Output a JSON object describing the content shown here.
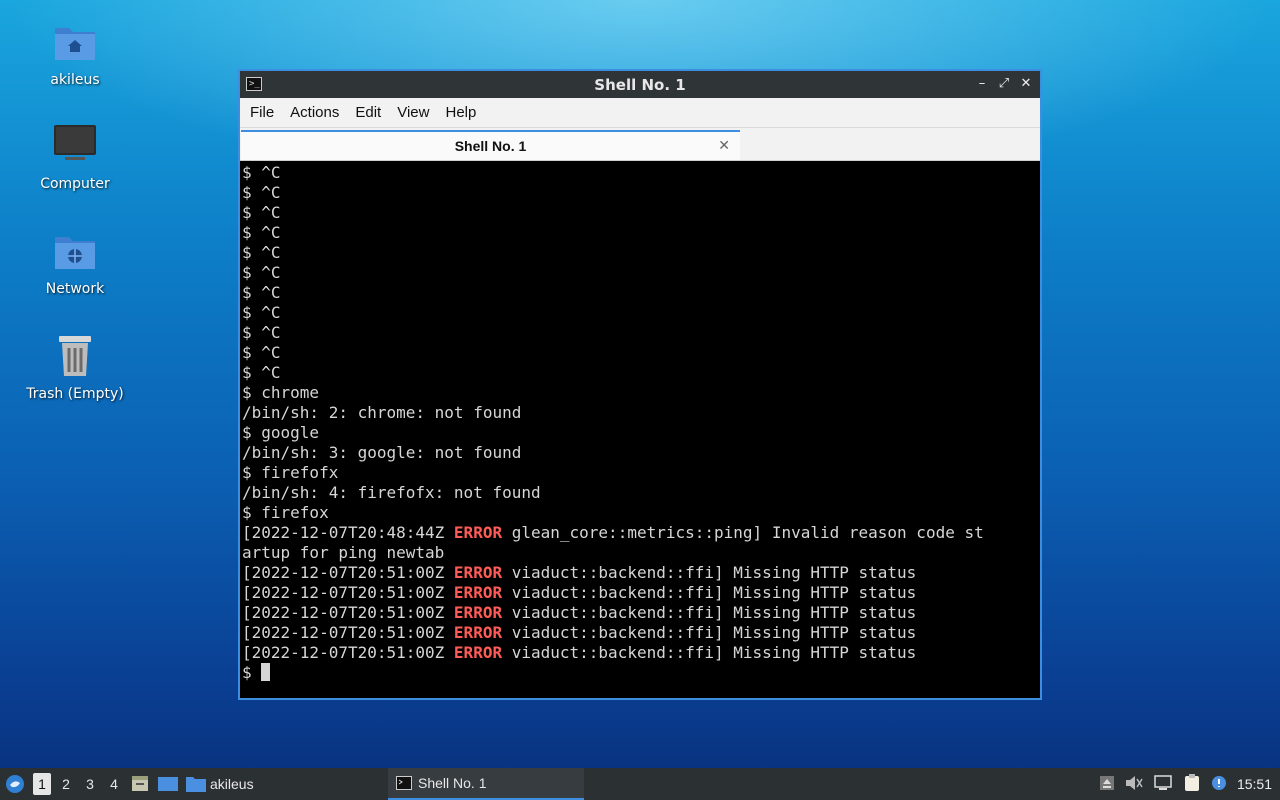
{
  "desktop": {
    "icons": [
      {
        "label": "akileus",
        "icon": "home-folder-icon"
      },
      {
        "label": "Computer",
        "icon": "computer-icon"
      },
      {
        "label": "Network",
        "icon": "network-folder-icon"
      },
      {
        "label": "Trash (Empty)",
        "icon": "trash-icon"
      }
    ]
  },
  "window": {
    "title": "Shell No. 1",
    "menu": [
      "File",
      "Actions",
      "Edit",
      "View",
      "Help"
    ],
    "tab_label": "Shell No. 1",
    "tab_close": "✕"
  },
  "terminal": {
    "lines": [
      [
        {
          "t": "$ ^C"
        }
      ],
      [
        {
          "t": "$ ^C"
        }
      ],
      [
        {
          "t": "$ ^C"
        }
      ],
      [
        {
          "t": "$ ^C"
        }
      ],
      [
        {
          "t": "$ ^C"
        }
      ],
      [
        {
          "t": "$ ^C"
        }
      ],
      [
        {
          "t": "$ ^C"
        }
      ],
      [
        {
          "t": "$ ^C"
        }
      ],
      [
        {
          "t": "$ ^C"
        }
      ],
      [
        {
          "t": "$ ^C"
        }
      ],
      [
        {
          "t": "$ ^C"
        }
      ],
      [
        {
          "t": "$ chrome"
        }
      ],
      [
        {
          "t": "/bin/sh: 2: chrome: not found"
        }
      ],
      [
        {
          "t": "$ google"
        }
      ],
      [
        {
          "t": "/bin/sh: 3: google: not found"
        }
      ],
      [
        {
          "t": "$ firefofx"
        }
      ],
      [
        {
          "t": "/bin/sh: 4: firefofx: not found"
        }
      ],
      [
        {
          "t": "$ firefox"
        }
      ],
      [
        {
          "t": "[2022-12-07T20:48:44Z "
        },
        {
          "t": "ERROR",
          "err": true
        },
        {
          "t": " glean_core::metrics::ping] Invalid reason code st"
        }
      ],
      [
        {
          "t": "artup for ping newtab"
        }
      ],
      [
        {
          "t": "[2022-12-07T20:51:00Z "
        },
        {
          "t": "ERROR",
          "err": true
        },
        {
          "t": " viaduct::backend::ffi] Missing HTTP status"
        }
      ],
      [
        {
          "t": "[2022-12-07T20:51:00Z "
        },
        {
          "t": "ERROR",
          "err": true
        },
        {
          "t": " viaduct::backend::ffi] Missing HTTP status"
        }
      ],
      [
        {
          "t": "[2022-12-07T20:51:00Z "
        },
        {
          "t": "ERROR",
          "err": true
        },
        {
          "t": " viaduct::backend::ffi] Missing HTTP status"
        }
      ],
      [
        {
          "t": "[2022-12-07T20:51:00Z "
        },
        {
          "t": "ERROR",
          "err": true
        },
        {
          "t": " viaduct::backend::ffi] Missing HTTP status"
        }
      ],
      [
        {
          "t": "[2022-12-07T20:51:00Z "
        },
        {
          "t": "ERROR",
          "err": true
        },
        {
          "t": " viaduct::backend::ffi] Missing HTTP status"
        }
      ]
    ],
    "prompt": "$ "
  },
  "taskbar": {
    "workspaces": [
      "1",
      "2",
      "3",
      "4"
    ],
    "active_workspace": "1",
    "folder_label": "akileus",
    "task_label": "Shell No. 1",
    "clock": "15:51"
  },
  "colors": {
    "accent": "#3d8ee0",
    "error": "#ff5c57",
    "terminal_bg": "#000000",
    "titlebar": "#2f3437"
  }
}
